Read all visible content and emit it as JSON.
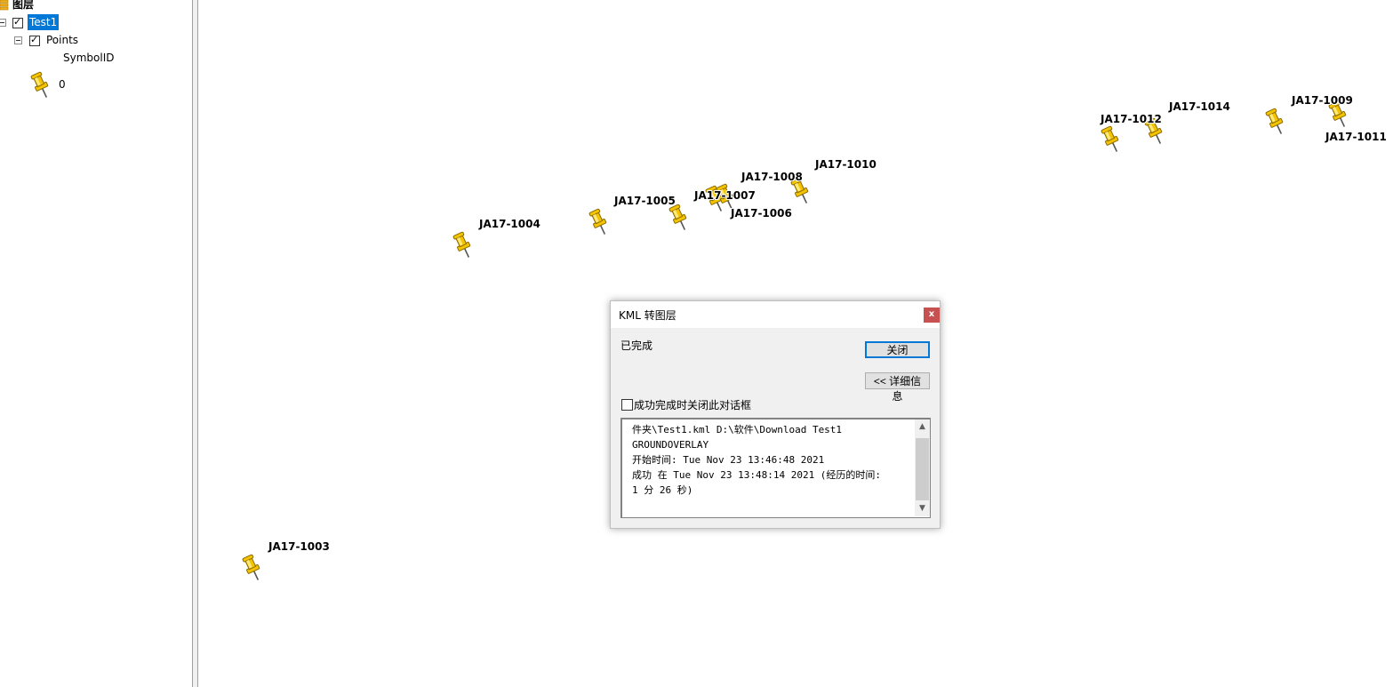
{
  "toc": {
    "root_label": "图层",
    "layer_name": "Test1",
    "sublayer_name": "Points",
    "field_name": "SymbolID",
    "symbol_value": "0",
    "layer_checked": true,
    "sublayer_checked": true
  },
  "map": {
    "pin_color": "#f5c400",
    "labels": {
      "p1003": "JA17-1003",
      "p1004": "JA17-1004",
      "p1005": "JA17-1005",
      "p1006": "JA17-1006",
      "p1007": "JA17-1007",
      "p1008": "JA17-1008",
      "p1009": "JA17-1009",
      "p1010": "JA17-1010",
      "p1011": "JA17-1011",
      "p1012": "JA17-1012",
      "p1014": "JA17-1014"
    }
  },
  "dialog": {
    "title": "KML 转图层",
    "close_icon": "x",
    "status": "已完成",
    "close_button": "关闭",
    "details_button": "<< 详细信息",
    "auto_close_label": "成功完成时关闭此对话框",
    "auto_close_checked": false,
    "log": "件夹\\Test1.kml D:\\软件\\Download Test1\nGROUNDOVERLAY\n开始时间: Tue Nov 23 13:46:48 2021\n成功 在 Tue Nov 23 13:48:14 2021 (经历的时间:\n1 分 26 秒)"
  }
}
